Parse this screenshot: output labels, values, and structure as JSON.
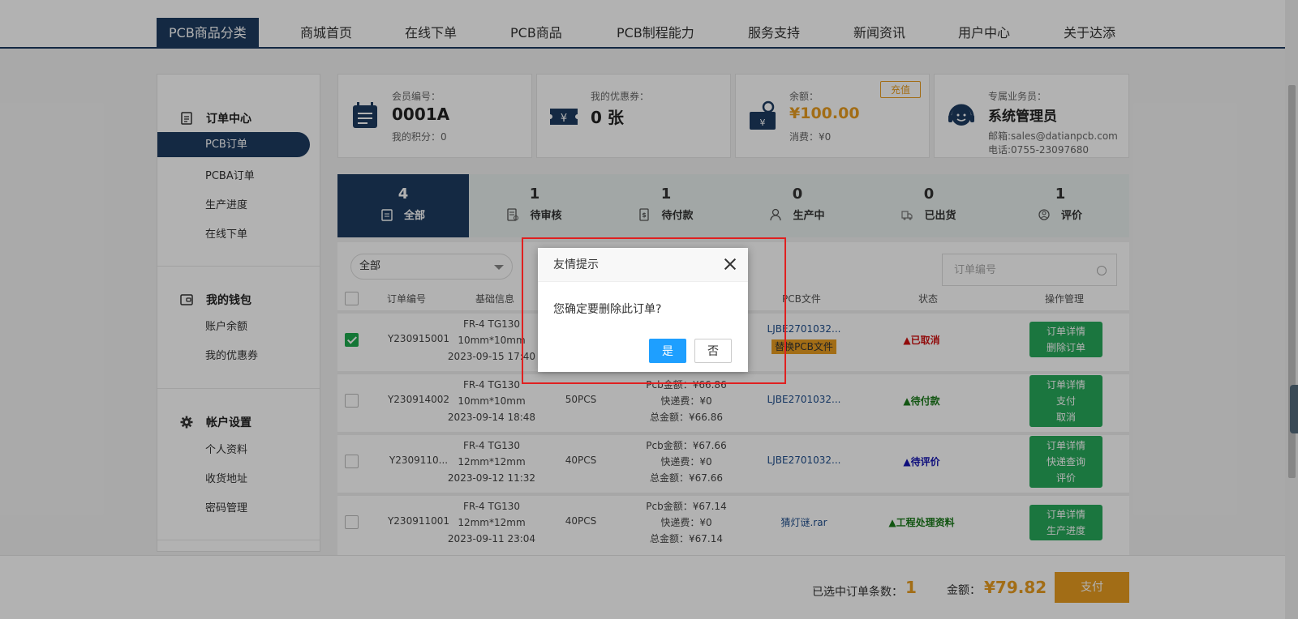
{
  "nav": {
    "items": [
      "PCB商品分类",
      "商城首页",
      "在线下单",
      "PCB商品",
      "PCB制程能力",
      "服务支持",
      "新闻资讯",
      "用户中心",
      "关于达添"
    ]
  },
  "sidebar": {
    "sections": [
      {
        "title": "订单中心",
        "icon": "order-list-icon",
        "links": [
          "PCB订单",
          "PCBA订单",
          "生产进度",
          "在线下单"
        ]
      },
      {
        "title": "我的钱包",
        "icon": "wallet-icon",
        "links": [
          "账户余额",
          "我的优惠券"
        ]
      },
      {
        "title": "帐户设置",
        "icon": "gear-icon",
        "links": [
          "个人资料",
          "收货地址",
          "密码管理"
        ]
      }
    ],
    "active_link": "PCB订单"
  },
  "cards": {
    "member": {
      "label": "会员编号：",
      "value": "0001A",
      "sub": "我的积分：0"
    },
    "coupon": {
      "label": "我的优惠券：",
      "value": "0 张"
    },
    "balance": {
      "label": "余额：",
      "value": "¥100.00",
      "sub": "消费：¥0",
      "recharge": "充值"
    },
    "agent": {
      "label": "专属业务员：",
      "value": "系统管理员",
      "email": "邮箱:sales@datianpcb.com",
      "phone": "电话:0755-23097680"
    }
  },
  "tabs": [
    {
      "count": "4",
      "label": "全部",
      "icon": "clipboard-icon"
    },
    {
      "count": "1",
      "label": "待审核",
      "icon": "review-doc-icon"
    },
    {
      "count": "1",
      "label": "待付款",
      "icon": "payment-doc-icon"
    },
    {
      "count": "0",
      "label": "生产中",
      "icon": "worker-icon"
    },
    {
      "count": "0",
      "label": "已出货",
      "icon": "shipping-icon"
    },
    {
      "count": "1",
      "label": "评价",
      "icon": "review-user-icon"
    }
  ],
  "filter": {
    "select": "全部",
    "search_placeholder": "订单编号"
  },
  "table": {
    "headers": [
      "订单编号",
      "基础信息",
      "PCB文件",
      "状态",
      "操作管理"
    ],
    "rows": [
      {
        "id": "Y230915001",
        "material": "FR-4 TG130",
        "size": "10mm*10mm",
        "date": "2023-09-15 17:40",
        "qty": "",
        "pcb_fee": "",
        "ship_fee": "",
        "total": "",
        "file": "LJBE2701032...",
        "file_action": "替换PCB文件",
        "status": "▲已取消",
        "status_color": "#d01010",
        "ops": [
          "订单详情",
          "删除订单"
        ],
        "checked": true
      },
      {
        "id": "Y230914002",
        "material": "FR-4 TG130",
        "size": "10mm*10mm",
        "date": "2023-09-14 18:48",
        "qty": "50PCS",
        "pcb_fee": "Pcb金额：¥66.86",
        "ship_fee": "快递费：¥0",
        "total": "总金额：¥66.86",
        "file": "LJBE2701032...",
        "file_action": "",
        "status": "▲待付款",
        "status_color": "#1a7a1a",
        "ops": [
          "订单详情",
          "支付",
          "取消"
        ],
        "checked": false
      },
      {
        "id": "Y2309110...",
        "material": "FR-4 TG130",
        "size": "12mm*12mm",
        "date": "2023-09-12 11:32",
        "qty": "40PCS",
        "pcb_fee": "Pcb金额：¥67.66",
        "ship_fee": "快递费：¥0",
        "total": "总金额：¥67.66",
        "file": "LJBE2701032...",
        "file_action": "",
        "status": "▲待评价",
        "status_color": "#1414b0",
        "ops": [
          "订单详情",
          "快递查询",
          "评价"
        ],
        "checked": false
      },
      {
        "id": "Y230911001",
        "material": "FR-4 TG130",
        "size": "12mm*12mm",
        "date": "2023-09-11 23:04",
        "qty": "40PCS",
        "pcb_fee": "Pcb金额：¥67.14",
        "ship_fee": "快递费：¥0",
        "total": "总金额：¥67.14",
        "file": "猜灯谜.rar",
        "file_action": "",
        "status": "▲工程处理资料",
        "status_color": "#1a7a1a",
        "ops": [
          "订单详情",
          "生产进度"
        ],
        "checked": false
      }
    ]
  },
  "bottom": {
    "selected_label": "已选中订单条数：",
    "selected_count": "1",
    "amount_label": "金额：",
    "amount": "¥79.82",
    "pay": "支付"
  },
  "dialog": {
    "title": "友情提示",
    "message": "您确定要删除此订单?",
    "yes": "是",
    "no": "否"
  },
  "colors": {
    "primary": "#1e3b60",
    "accent": "#e89c20",
    "green": "#27a95b",
    "dialog_blue": "#1e9fff",
    "highlight": "#e02020"
  }
}
